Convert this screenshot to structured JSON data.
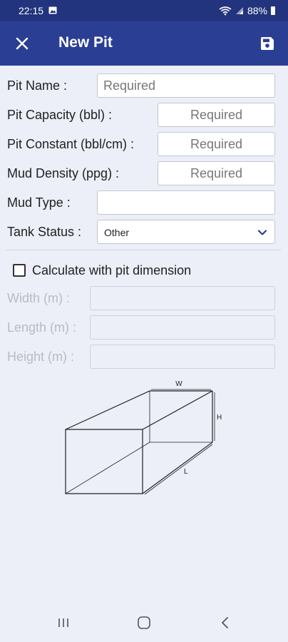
{
  "status_bar": {
    "time": "22:15",
    "battery": "88%"
  },
  "app_bar": {
    "title": "New Pit"
  },
  "form": {
    "pit_name": {
      "label": "Pit Name :",
      "placeholder": "Required"
    },
    "pit_capacity": {
      "label": "Pit Capacity (bbl) :",
      "placeholder": "Required"
    },
    "pit_constant": {
      "label": "Pit Constant (bbl/cm) :",
      "placeholder": "Required"
    },
    "mud_density": {
      "label": "Mud Density (ppg) :",
      "placeholder": "Required"
    },
    "mud_type": {
      "label": "Mud Type :",
      "placeholder": ""
    },
    "tank_status": {
      "label": "Tank Status :",
      "value": "Other"
    },
    "calc_checkbox": {
      "label": "Calculate with pit dimension",
      "checked": false
    },
    "width": {
      "label": "Width (m) :"
    },
    "length": {
      "label": "Length (m) :"
    },
    "height": {
      "label": "Height (m) :"
    }
  },
  "diagram": {
    "w_label": "W",
    "h_label": "H",
    "l_label": "L"
  },
  "colors": {
    "status_bar": "#22347d",
    "app_bar": "#2a3f94",
    "background": "#eceef8"
  },
  "icons": {
    "close": "close-icon",
    "save": "save-icon",
    "dropdown": "chevron-down-icon"
  }
}
